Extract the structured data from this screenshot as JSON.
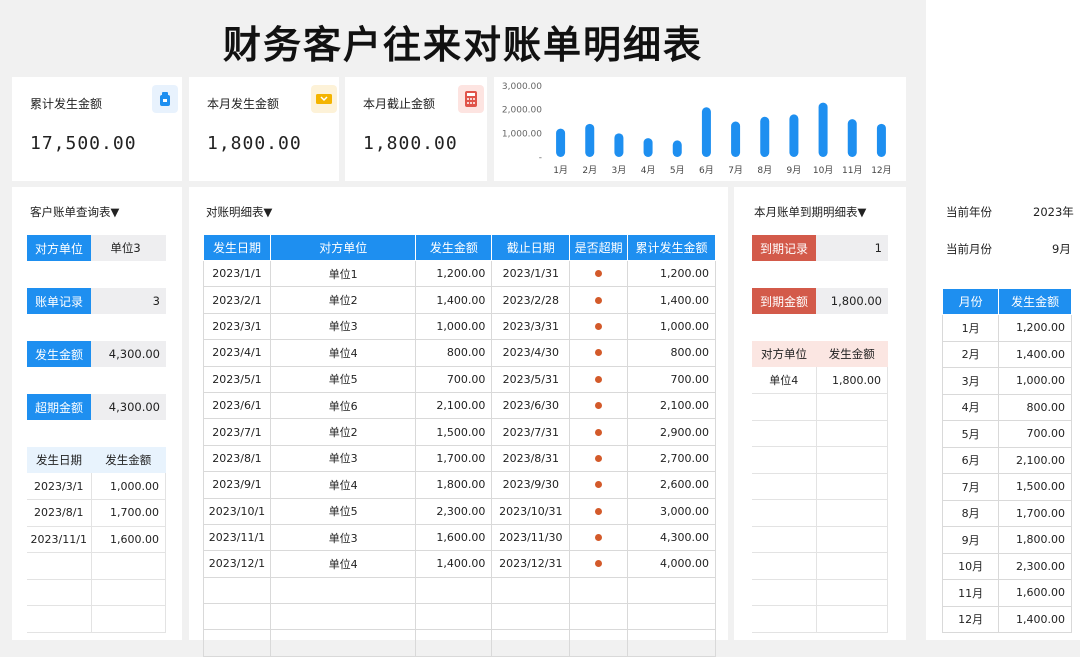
{
  "title": "财务客户往来对账单明细表",
  "cards": [
    {
      "label": "累计发生金额",
      "value": "17,500.00",
      "icon": "wallet-icon"
    },
    {
      "label": "本月发生金额",
      "value": "1,800.00",
      "icon": "ticket-icon"
    },
    {
      "label": "本月截止金额",
      "value": "1,800.00",
      "icon": "calculator-icon"
    }
  ],
  "chart_data": {
    "type": "bar",
    "categories": [
      "1月",
      "2月",
      "3月",
      "4月",
      "5月",
      "6月",
      "7月",
      "8月",
      "9月",
      "10月",
      "11月",
      "12月"
    ],
    "values": [
      1200,
      1400,
      1000,
      800,
      700,
      2100,
      1500,
      1700,
      1800,
      2300,
      1600,
      1400
    ],
    "ytick_labels": [
      "3,000.00",
      "2,000.00",
      "1,000.00",
      "-"
    ],
    "ylim": [
      0,
      3000
    ],
    "color": "#1e8ff0"
  },
  "query": {
    "title": "客户账单查询表▼",
    "rows": [
      {
        "label": "对方单位",
        "value": "单位3"
      },
      {
        "label": "账单记录",
        "value": "3"
      },
      {
        "label": "发生金额",
        "value": "4,300.00"
      },
      {
        "label": "超期金额",
        "value": "4,300.00"
      }
    ],
    "table_headers": [
      "发生日期",
      "发生金额"
    ],
    "table_rows": [
      [
        "2023/3/1",
        "1,000.00"
      ],
      [
        "2023/8/1",
        "1,700.00"
      ],
      [
        "2023/11/1",
        "1,600.00"
      ]
    ]
  },
  "detail": {
    "title": "对账明细表▼",
    "headers": [
      "发生日期",
      "对方单位",
      "发生金额",
      "截止日期",
      "是否超期",
      "累计发生金额"
    ],
    "rows": [
      [
        "2023/1/1",
        "单位1",
        "1,200.00",
        "2023/1/31",
        "1,200.00"
      ],
      [
        "2023/2/1",
        "单位2",
        "1,400.00",
        "2023/2/28",
        "1,400.00"
      ],
      [
        "2023/3/1",
        "单位3",
        "1,000.00",
        "2023/3/31",
        "1,000.00"
      ],
      [
        "2023/4/1",
        "单位4",
        "800.00",
        "2023/4/30",
        "800.00"
      ],
      [
        "2023/5/1",
        "单位5",
        "700.00",
        "2023/5/31",
        "700.00"
      ],
      [
        "2023/6/1",
        "单位6",
        "2,100.00",
        "2023/6/30",
        "2,100.00"
      ],
      [
        "2023/7/1",
        "单位2",
        "1,500.00",
        "2023/7/31",
        "2,900.00"
      ],
      [
        "2023/8/1",
        "单位3",
        "1,700.00",
        "2023/8/31",
        "2,700.00"
      ],
      [
        "2023/9/1",
        "单位4",
        "1,800.00",
        "2023/9/30",
        "2,600.00"
      ],
      [
        "2023/10/1",
        "单位5",
        "2,300.00",
        "2023/10/31",
        "3,000.00"
      ],
      [
        "2023/11/1",
        "单位3",
        "1,600.00",
        "2023/11/30",
        "4,300.00"
      ],
      [
        "2023/12/1",
        "单位4",
        "1,400.00",
        "2023/12/31",
        "4,000.00"
      ]
    ],
    "overdue_color": "#d35a2a"
  },
  "due": {
    "title": "本月账单到期明细表▼",
    "record_label": "到期记录",
    "record_value": "1",
    "amount_label": "到期金额",
    "amount_value": "1,800.00",
    "headers": [
      "对方单位",
      "发生金额"
    ],
    "rows": [
      [
        "单位4",
        "1,800.00"
      ]
    ]
  },
  "side": {
    "year_label": "当前年份",
    "year_value": "2023年",
    "month_label": "当前月份",
    "month_value": "9月",
    "headers": [
      "月份",
      "发生金额"
    ],
    "rows": [
      [
        "1月",
        "1,200.00"
      ],
      [
        "2月",
        "1,400.00"
      ],
      [
        "3月",
        "1,000.00"
      ],
      [
        "4月",
        "800.00"
      ],
      [
        "5月",
        "700.00"
      ],
      [
        "6月",
        "2,100.00"
      ],
      [
        "7月",
        "1,500.00"
      ],
      [
        "8月",
        "1,700.00"
      ],
      [
        "9月",
        "1,800.00"
      ],
      [
        "10月",
        "2,300.00"
      ],
      [
        "11月",
        "1,600.00"
      ],
      [
        "12月",
        "1,400.00"
      ]
    ]
  }
}
